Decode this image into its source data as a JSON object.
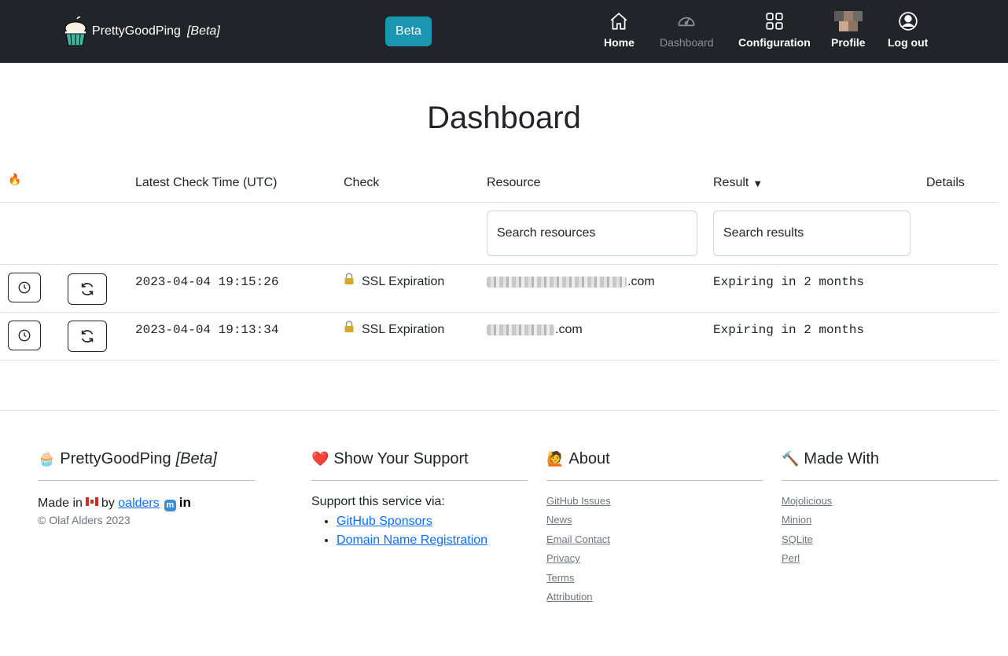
{
  "navbar": {
    "brand_name": "PrettyGoodPing",
    "brand_tag": "[Beta]",
    "beta_button": "Beta",
    "items": {
      "home": "Home",
      "dashboard": "Dashboard",
      "configuration": "Configuration",
      "profile": "Profile",
      "logout": "Log out"
    }
  },
  "page": {
    "title": "Dashboard"
  },
  "table": {
    "headers": {
      "fire_icon": "🔥",
      "time": "Latest Check Time (UTC)",
      "check": "Check",
      "resource": "Resource",
      "result": "Result",
      "result_sort": "▼",
      "details": "Details"
    },
    "search_resources_placeholder": "Search resources",
    "search_results_placeholder": "Search results",
    "rows": [
      {
        "time": "2023-04-04 19:15:26",
        "check": "SSL Expiration",
        "resource_suffix": ".com",
        "result": "Expiring in 2 months"
      },
      {
        "time": "2023-04-04 19:13:34",
        "check": "SSL Expiration",
        "resource_suffix": ".com",
        "result": "Expiring in 2 months"
      }
    ]
  },
  "footer": {
    "brand": {
      "emoji": "🧁",
      "name": "PrettyGoodPing",
      "tag": "[Beta]",
      "made_in": "Made in",
      "by": "by",
      "author_link": "oalders",
      "copyright": "© Olaf Alders 2023"
    },
    "support": {
      "emoji": "❤️",
      "title": "Show Your Support",
      "intro": "Support this service via:",
      "links": [
        "GitHub Sponsors",
        "Domain Name Registration"
      ]
    },
    "about": {
      "emoji": "🙋",
      "title": "About",
      "links": [
        "GitHub Issues",
        "News",
        "Email Contact",
        "Privacy",
        "Terms",
        "Attribution"
      ]
    },
    "made_with": {
      "emoji": "🔨",
      "title": "Made With",
      "links": [
        "Mojolicious",
        "Minion",
        "SQLite",
        "Perl"
      ]
    }
  },
  "colors": {
    "navbar_bg": "#212529",
    "beta_button": "#1a96b0",
    "link": "#0d6efd"
  }
}
